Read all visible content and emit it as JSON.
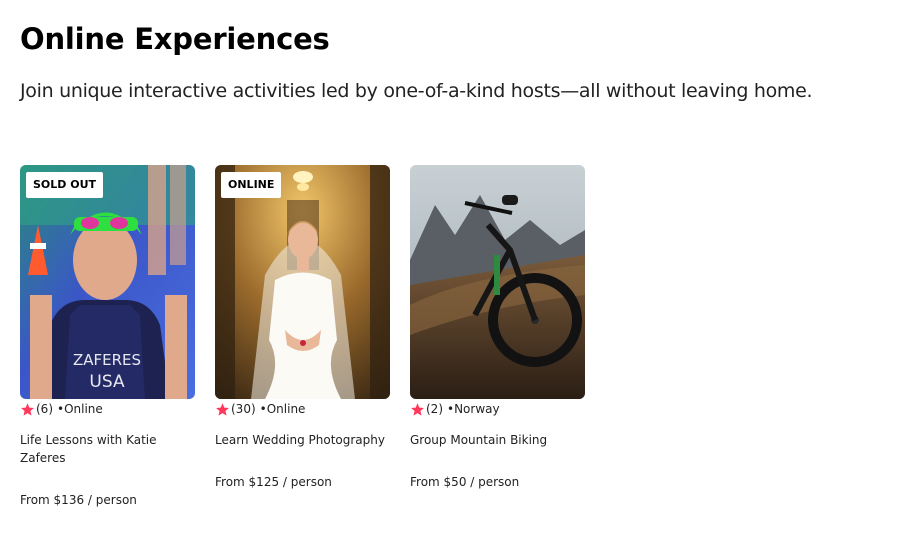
{
  "header": {
    "title": "Online Experiences",
    "subtitle": "Join unique interactive activities led by one-of-a-kind hosts—all without leaving home."
  },
  "colors": {
    "star": "#FF385C",
    "badge_bg": "#FFFFFF"
  },
  "cards": [
    {
      "badge": "SOLD OUT",
      "rating_count": "(6)",
      "separator": "•",
      "location": "Online",
      "title": "Life Lessons with Katie Zaferes",
      "price": "From $136 / person",
      "image_alt": "photo of athlete in swimsuit with goggles"
    },
    {
      "badge": "ONLINE",
      "rating_count": "(30)",
      "separator": "•",
      "location": "Online",
      "title": "Learn Wedding Photography",
      "price": "From $125 / person",
      "image_alt": "photo of bride in white dress"
    },
    {
      "badge": "",
      "rating_count": "(2)",
      "separator": "•",
      "location": "Norway",
      "title": "Group Mountain Biking",
      "price": "From $50 / person",
      "image_alt": "photo of mountain bike on hillside"
    }
  ]
}
